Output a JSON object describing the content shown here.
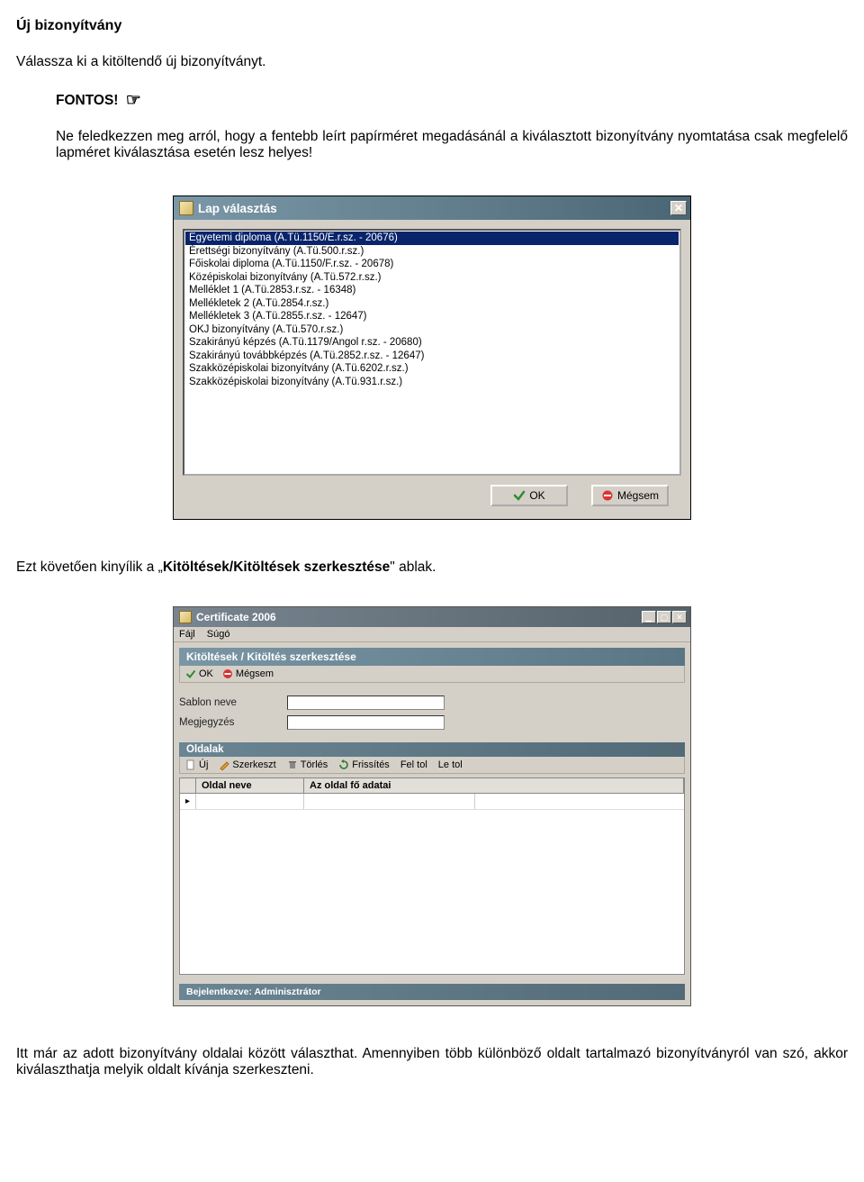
{
  "doc": {
    "heading": "Új bizonyítvány",
    "intro": "Válassza ki a kitöltendő új bizonyítványt.",
    "important_label": "FONTOS!",
    "hand_icon": "☞",
    "warning": "Ne feledkezzen meg arról, hogy a fentebb leírt papírméret megadásánál a kiválasztott bizonyítvány nyomtatása csak megfelelő lapméret kiválasztása esetén lesz helyes!",
    "mid_pre": "Ezt követően kinyílik a „",
    "mid_bold": "Kitöltések/Kitöltések szerkesztése",
    "mid_post": "\" ablak.",
    "closing": "Itt már az adott bizonyítvány oldalai között választhat. Amennyiben több különböző oldalt tartalmazó bizonyítványról van szó, akkor kiválaszthatja melyik oldalt kívánja szerkeszteni."
  },
  "dialog1": {
    "title": "Lap választás",
    "items": [
      "Egyetemi diploma (A.Tü.1150/E.r.sz. - 20676)",
      "Érettségi bizonyítvány (A.Tü.500.r.sz.)",
      "Főiskolai diploma (A.Tü.1150/F.r.sz. - 20678)",
      "Középiskolai bizonyítvány (A.Tü.572.r.sz.)",
      "Melléklet 1 (A.Tü.2853.r.sz. - 16348)",
      "Mellékletek 2 (A.Tü.2854.r.sz.)",
      "Mellékletek 3 (A.Tü.2855.r.sz. - 12647)",
      "OKJ bizonyítvány (A.Tü.570.r.sz.)",
      "Szakirányú képzés (A.Tü.1179/Angol r.sz. - 20680)",
      "Szakirányú továbbképzés (A.Tü.2852.r.sz. - 12647)",
      "Szakközépiskolai bizonyítvány (A.Tü.6202.r.sz.)",
      "Szakközépiskolai bizonyítvány (A.Tü.931.r.sz.)"
    ],
    "selected_index": 0,
    "ok": "OK",
    "cancel": "Mégsem"
  },
  "dialog2": {
    "title": "Certificate 2006",
    "menu": {
      "file": "Fájl",
      "help": "Súgó"
    },
    "panel_title": "Kitöltések / Kitöltés szerkesztése",
    "toolbar": {
      "ok": "OK",
      "cancel": "Mégsem"
    },
    "form": {
      "template_label": "Sablon neve",
      "note_label": "Megjegyzés"
    },
    "section_title": "Oldalak",
    "subtoolbar": {
      "new": "Új",
      "edit": "Szerkeszt",
      "delete": "Törlés",
      "refresh": "Frissítés",
      "up": "Fel tol",
      "down": "Le tol"
    },
    "grid": {
      "col1": "Oldal neve",
      "col2": "Az oldal fő adatai"
    },
    "status": "Bejelentkezve: Adminisztrátor"
  }
}
